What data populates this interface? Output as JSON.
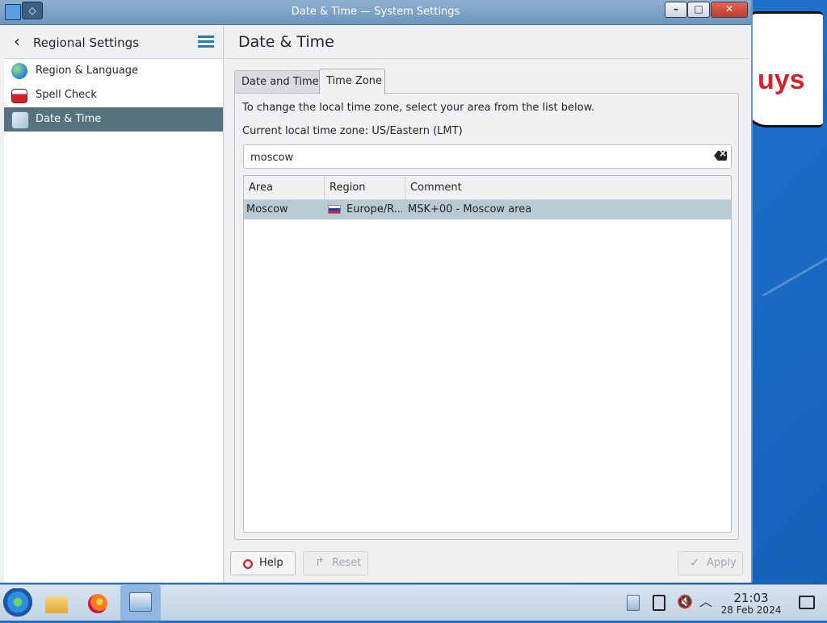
{
  "window": {
    "title": "Date & Time — System Settings"
  },
  "sidebar": {
    "title": "Regional Settings",
    "items": [
      {
        "label": "Region & Language",
        "icon": "globe-icon"
      },
      {
        "label": "Spell Check",
        "icon": "spell-check-icon"
      },
      {
        "label": "Date & Time",
        "icon": "date-time-icon",
        "active": true
      }
    ]
  },
  "main": {
    "title": "Date & Time",
    "tabs": [
      {
        "label": "Date and Time"
      },
      {
        "label": "Time Zone",
        "active": true
      }
    ],
    "help_text": "To change the local time zone, select your area from the list below.",
    "current_tz": "Current local time zone: US/Eastern (LMT)",
    "search": {
      "value": "moscow",
      "placeholder": ""
    },
    "table": {
      "headers": [
        "Area",
        "Region",
        "Comment"
      ],
      "rows": [
        {
          "area": "Moscow",
          "region": "Europe/R...",
          "comment": "MSK+00 - Moscow area",
          "selected": true
        }
      ]
    }
  },
  "buttons": {
    "help": "Help",
    "reset": "Reset",
    "apply": "Apply"
  },
  "desktop": {
    "banner_fragment": "uys"
  },
  "taskbar": {
    "time": "21:03",
    "date": "28 Feb 2024"
  },
  "colors": {
    "accent": "#2a7ab8",
    "selection": "#55727f",
    "row_selection": "#b8cad2",
    "titlebar": "#6d95bd"
  }
}
